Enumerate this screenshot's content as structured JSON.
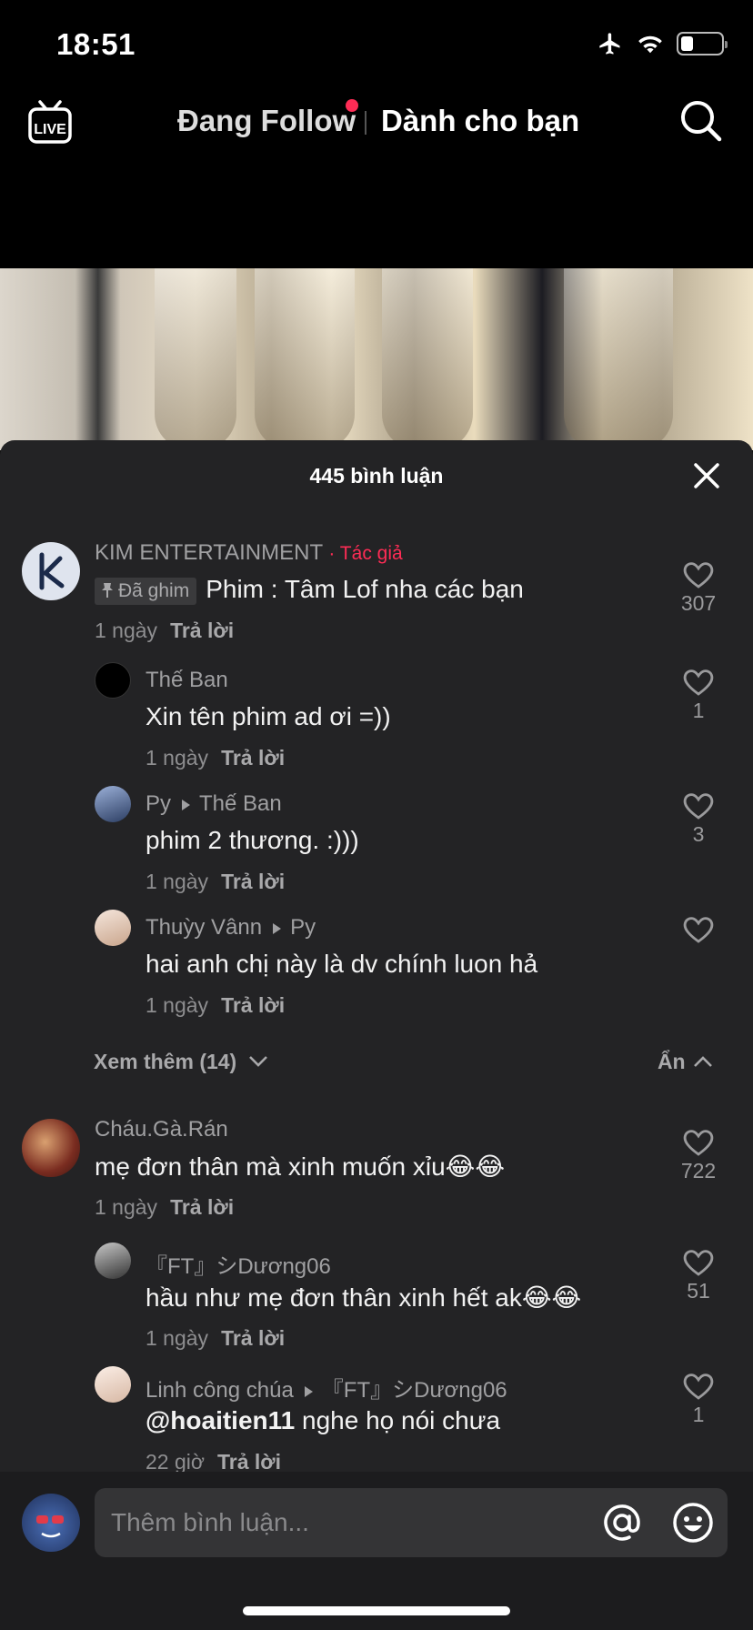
{
  "status": {
    "time": "18:51",
    "battery_level": 0.3
  },
  "topnav": {
    "live_label": "LIVE",
    "tab_following": "Đang Follow",
    "tab_foryou": "Dành cho bạn"
  },
  "comments_panel": {
    "title": "445 bình luận",
    "view_more": "Xem thêm (14)",
    "hide": "Ẩn",
    "comments": [
      {
        "user": "KIM ENTERTAINMENT",
        "author_tag": "· Tác giả",
        "pinned": "Đã ghim",
        "text": "Phim : Tâm Lof nha các bạn",
        "time": "1 ngày",
        "reply": "Trả lời",
        "likes": "307"
      },
      {
        "user": "Thế Ban",
        "text": "Xin tên phim ad ơi =))",
        "time": "1 ngày",
        "reply": "Trả lời",
        "likes": "1"
      },
      {
        "user": "Py",
        "reply_to": "Thế Ban",
        "text": "phim 2 thương. :)))",
        "time": "1 ngày",
        "reply": "Trả lời",
        "likes": "3"
      },
      {
        "user": "Thuỳy Vânn",
        "reply_to": "Py",
        "text": "hai anh chị này là dv chính luon hả",
        "time": "1 ngày",
        "reply": "Trả lời",
        "likes": ""
      },
      {
        "user": "Cháu.Gà.Rán",
        "text": "mẹ đơn thân mà xinh muốn xỉu😂😂",
        "time": "1 ngày",
        "reply": "Trả lời",
        "likes": "722"
      },
      {
        "user": "『FT』シDương06",
        "text": "hầu như mẹ đơn thân xinh hết ak😂😂",
        "time": "1 ngày",
        "reply": "Trả lời",
        "likes": "51"
      },
      {
        "user": "Linh công chúa",
        "reply_to": "『FT』シDương06",
        "mention": "@hoaitien11",
        "text": " nghe họ nói chưa",
        "time": "22 giờ",
        "reply": "Trả lời",
        "likes": "1"
      }
    ]
  },
  "input": {
    "placeholder": "Thêm bình luận..."
  },
  "icons": [
    "airplane-icon",
    "wifi-icon",
    "battery-icon",
    "live-tv-icon",
    "search-icon",
    "close-icon",
    "heart-icon",
    "pin-icon",
    "chevron-down-icon",
    "chevron-up-icon",
    "at-icon",
    "emoji-icon"
  ],
  "colors": {
    "accent": "#fe2c55",
    "panel_bg": "#232325",
    "text_muted": "#a0a0a2"
  }
}
